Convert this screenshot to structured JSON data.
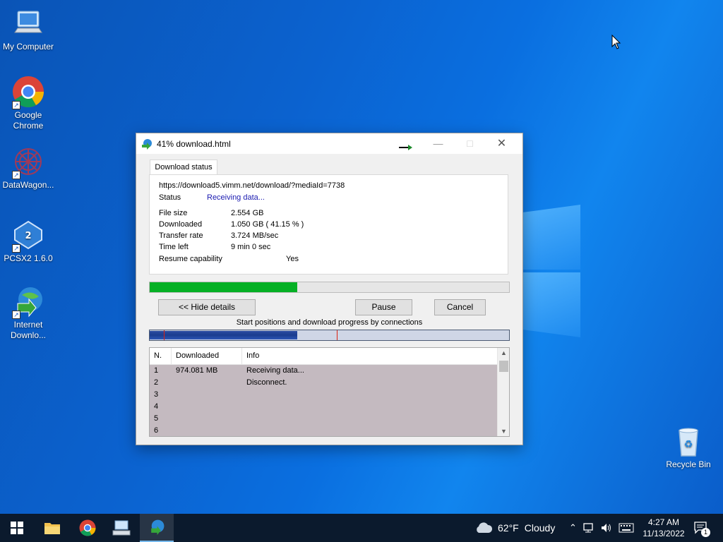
{
  "desktop": {
    "icons": [
      {
        "label": "My Computer",
        "icon": "computer-icon"
      },
      {
        "label": "Google Chrome",
        "icon": "chrome-icon"
      },
      {
        "label": "DataWagon...",
        "icon": "datawagon-icon"
      },
      {
        "label": "PCSX2 1.6.0",
        "icon": "pcsx2-icon"
      },
      {
        "label": "Internet Downlo...",
        "icon": "idm-icon"
      },
      {
        "label": "Recycle Bin",
        "icon": "recycle-bin-icon"
      }
    ]
  },
  "window": {
    "title": "41% download.html",
    "tab_label": "Download status",
    "url": "https://download5.vimm.net/download/?mediaId=7738",
    "status_label": "Status",
    "status_value": "Receiving data...",
    "file_size_label": "File size",
    "file_size_value": "2.554  GB",
    "downloaded_label": "Downloaded",
    "downloaded_value": "1.050  GB  ( 41.15 % )",
    "transfer_rate_label": "Transfer rate",
    "transfer_rate_value": "3.724  MB/sec",
    "time_left_label": "Time left",
    "time_left_value": "9 min 0 sec",
    "resume_label": "Resume capability",
    "resume_value": "Yes",
    "progress_percent": 41.15,
    "hide_details_label": "<< Hide details",
    "pause_label": "Pause",
    "cancel_label": "Cancel",
    "connections_caption": "Start positions and download progress by connections",
    "connections_progress": [
      {
        "start": 0.0,
        "end": 0.41
      }
    ],
    "connection_markers": [
      0.04,
      0.52
    ],
    "table": {
      "headers": [
        "N.",
        "Downloaded",
        "Info"
      ],
      "rows": [
        {
          "n": "1",
          "downloaded": "974.081  MB",
          "info": "Receiving data..."
        },
        {
          "n": "2",
          "downloaded": "",
          "info": "Disconnect."
        },
        {
          "n": "3",
          "downloaded": "",
          "info": ""
        },
        {
          "n": "4",
          "downloaded": "",
          "info": ""
        },
        {
          "n": "5",
          "downloaded": "",
          "info": ""
        },
        {
          "n": "6",
          "downloaded": "",
          "info": ""
        }
      ]
    }
  },
  "taskbar": {
    "weather_temp": "62°F",
    "weather_desc": "Cloudy",
    "time": "4:27 AM",
    "date": "11/13/2022",
    "notification_count": "1"
  },
  "colors": {
    "progress_fill": "#06b025",
    "desktop_blue": "#0b62cf",
    "taskbar": "#0b1a2d"
  }
}
